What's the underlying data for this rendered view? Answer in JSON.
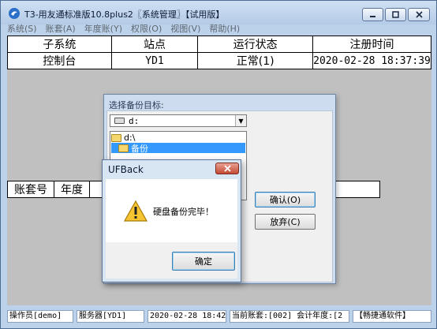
{
  "window": {
    "title": "T3-用友通标准版10.8plus2〖系统管理〗【试用版】",
    "min_glyph": "▁",
    "max_glyph": "□",
    "close_glyph": "✕"
  },
  "menu": [
    {
      "label": "系统(S)"
    },
    {
      "label": "账套(A)"
    },
    {
      "label": "年度账(Y)"
    },
    {
      "label": "权限(O)"
    },
    {
      "label": "视图(V)"
    },
    {
      "label": "帮助(H)"
    }
  ],
  "top_table": {
    "headers": [
      "子系统",
      "站点",
      "运行状态",
      "注册时间"
    ],
    "rows": [
      [
        "控制台",
        "YD1",
        "正常(1)",
        "2020-02-28 18:37:39"
      ]
    ]
  },
  "low_table": {
    "headers": [
      "账套号",
      "年度"
    ]
  },
  "backup_dialog": {
    "caption": "选择备份目标:",
    "drive_value": "d:",
    "folders": [
      "d:\\",
      "备份"
    ],
    "ok_label": "确认(O)",
    "cancel_label": "放弃(C)"
  },
  "message_box": {
    "title": "UFBack",
    "message": "硬盘备份完毕！",
    "confirm_label": "确定",
    "icon": "warning-icon"
  },
  "status_bar": {
    "operator": "操作员[demo]",
    "server": "服务器[YD1]",
    "datetime": "2020-02-28 18:42",
    "account": "当前账套:[002] 会计年度:[2",
    "brand": "【畅捷通软件】"
  },
  "colors": {
    "titlebar": "#b4cbe6",
    "selection": "#3399ff",
    "close_button": "#c44a34"
  }
}
